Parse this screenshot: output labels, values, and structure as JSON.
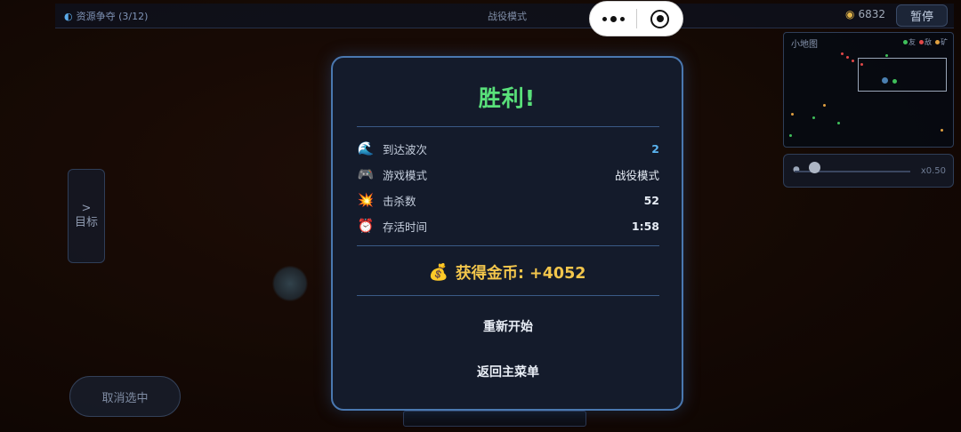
{
  "top_bar": {
    "objective": "资源争夺 (3/12)",
    "mode": "战役模式",
    "gold": "6832",
    "pause_label": "暂停"
  },
  "minimap": {
    "title": "小地图",
    "legend": [
      "友",
      "敌",
      "矿"
    ],
    "legend_colors": [
      "#3fbf5a",
      "#e04848",
      "#e0a040"
    ]
  },
  "zoom": {
    "value": "x0.50"
  },
  "left_panel": {
    "arrow": ">",
    "target_label": "目标"
  },
  "deselect_label": "取消选中",
  "result": {
    "title": "胜利!",
    "stats": [
      {
        "icon": "wave-icon",
        "glyph": "🌊",
        "label": "到达波次",
        "value": "2"
      },
      {
        "icon": "gamepad-icon",
        "glyph": "🎮",
        "label": "游戏模式",
        "value": "战役模式"
      },
      {
        "icon": "explosion-icon",
        "glyph": "💥",
        "label": "击杀数",
        "value": "52"
      },
      {
        "icon": "alarm-clock-icon",
        "glyph": "⏰",
        "label": "存活时间",
        "value": "1:58"
      }
    ],
    "reward": "获得金币: +4052",
    "restart_label": "重新开始",
    "menu_label": "返回主菜单"
  }
}
